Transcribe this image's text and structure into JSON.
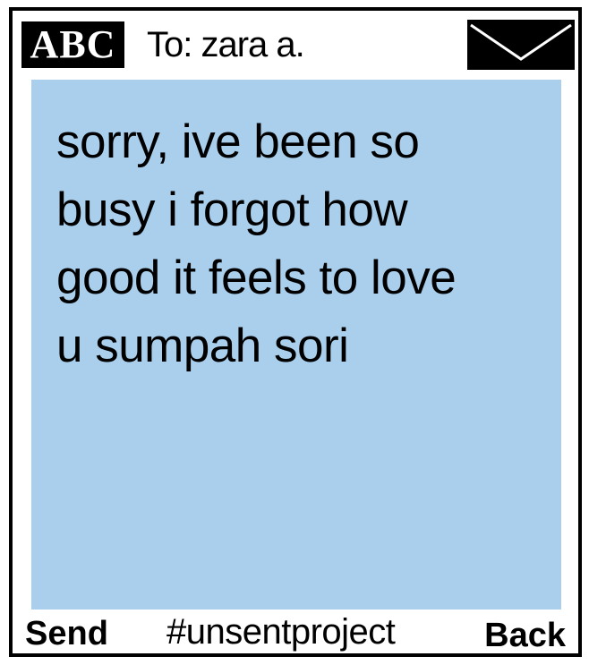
{
  "header": {
    "logo_text": "ABC",
    "recipient_line": "To: zara a.",
    "envelope_icon": "envelope-icon"
  },
  "message": {
    "text": "sorry, ive been so\nbusy i forgot how\ngood it feels to love\nu sumpah sori"
  },
  "footer": {
    "send_label": "Send",
    "hashtag": "#unsentproject",
    "back_label": "Back"
  },
  "colors": {
    "message_background": "#a9cfec",
    "frame": "#000000",
    "page": "#ffffff"
  }
}
